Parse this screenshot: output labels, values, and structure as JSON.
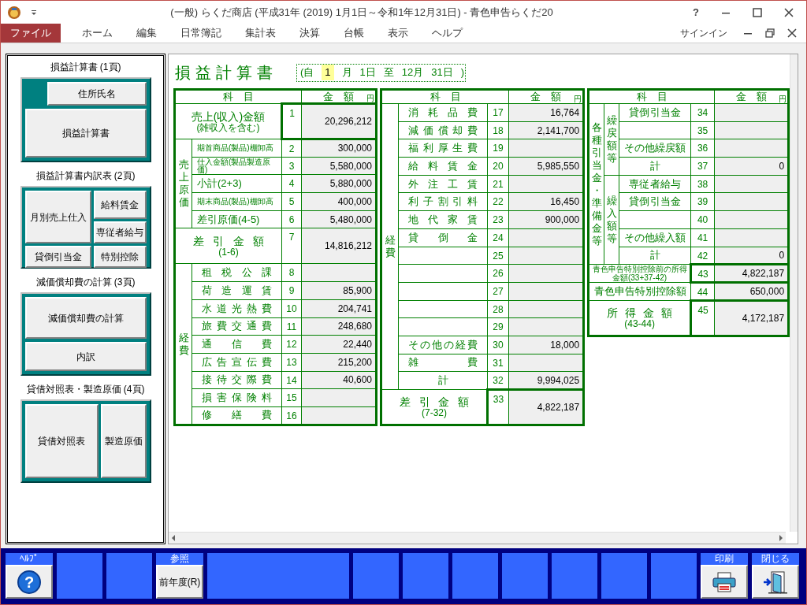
{
  "window": {
    "title": "(一般) らくだ商店 (平成31年 (2019) 1月1日～令和1年12月31日) - 青色申告らくだ20",
    "help": "?"
  },
  "menu": {
    "items": [
      {
        "label": "ファイル",
        "selected": true
      },
      {
        "label": "ホーム",
        "selected": false
      },
      {
        "label": "編集",
        "selected": false
      },
      {
        "label": "日常簿記",
        "selected": false
      },
      {
        "label": "集計表",
        "selected": false
      },
      {
        "label": "決算",
        "selected": false
      },
      {
        "label": "台帳",
        "selected": false
      },
      {
        "label": "表示",
        "selected": false
      },
      {
        "label": "ヘルプ",
        "selected": false
      }
    ],
    "signin": "サインイン"
  },
  "sidebar": {
    "sections": [
      {
        "title": "損益計算書 (1頁)",
        "kind": "offset",
        "buttons": [
          "住所氏名",
          "損益計算書"
        ]
      },
      {
        "title": "損益計算書内訳表 (2頁)",
        "kind": "grid",
        "buttons": [
          "月別売上仕入",
          "貸倒引当金",
          "給料賃金",
          "専従者給与",
          "特別控除"
        ]
      },
      {
        "title": "減価償却費の計算 (3頁)",
        "kind": "stack",
        "buttons": [
          "減価償却費の計算",
          "内訳"
        ]
      },
      {
        "title": "貸借対照表・製造原価 (4頁)",
        "kind": "columns",
        "buttons": [
          "貸借対照表",
          "製造原価"
        ]
      }
    ]
  },
  "form": {
    "title": "損益計算書",
    "period": [
      {
        "text": "(自",
        "highlighted": false
      },
      {
        "text": "1",
        "highlighted": true
      },
      {
        "text": "月",
        "highlighted": false
      },
      {
        "text": "1日",
        "highlighted": false
      },
      {
        "text": "至",
        "highlighted": false
      },
      {
        "text": "12月",
        "highlighted": false
      },
      {
        "text": "31日",
        "highlighted": false
      },
      {
        "text": ")",
        "highlighted": false
      }
    ],
    "tables": [
      {
        "columns": [
          {
            "label": "科　目"
          },
          {
            "label": "金　額",
            "unit": "円"
          }
        ],
        "blocks": [
          {
            "kind": "total-center",
            "label": "売上(収入)金額",
            "note": "(雑収入を含む)",
            "no": "1",
            "amount": "20,296,212",
            "emphasized": true
          },
          {
            "kind": "group",
            "label": "売上原価",
            "children": [
              {
                "kind": "row-left-small",
                "label": "期首商品(製品)棚卸高",
                "no": "2",
                "amount": "300,000"
              },
              {
                "kind": "row-left-small",
                "label": "仕入金額(製品製造原価)",
                "no": "3",
                "amount": "5,580,000"
              },
              {
                "kind": "row-left",
                "label": "小計(2+3)",
                "no": "4",
                "amount": "5,880,000"
              },
              {
                "kind": "row-left-small",
                "label": "期末商品(製品)棚卸高",
                "no": "5",
                "amount": "400,000"
              },
              {
                "kind": "row-left",
                "label": "差引原価(4-5)",
                "no": "6",
                "amount": "5,480,000"
              }
            ]
          },
          {
            "kind": "total-spread",
            "label": "差引金額",
            "note": "(1-6)",
            "no": "7",
            "amount": "14,816,212",
            "emphasized": false
          },
          {
            "kind": "group",
            "label": "経費",
            "children": [
              {
                "kind": "row-spread",
                "label": "租税公課",
                "no": "8"
              },
              {
                "kind": "row-spread",
                "label": "荷造運賃",
                "no": "9",
                "amount": "85,900"
              },
              {
                "kind": "row-spread",
                "label": "水道光熱費",
                "no": "10",
                "amount": "204,741"
              },
              {
                "kind": "row-spread",
                "label": "旅費交通費",
                "no": "11",
                "amount": "248,680"
              },
              {
                "kind": "row-spread",
                "label": "通信費",
                "no": "12",
                "amount": "22,440"
              },
              {
                "kind": "row-spread",
                "label": "広告宣伝費",
                "no": "13",
                "amount": "215,200"
              },
              {
                "kind": "row-spread",
                "label": "接待交際費",
                "no": "14",
                "amount": "40,600"
              },
              {
                "kind": "row-spread",
                "label": "損害保険料",
                "no": "15"
              },
              {
                "kind": "row-spread",
                "label": "修繕費",
                "no": "16"
              }
            ]
          }
        ]
      },
      {
        "columns": [
          {
            "label": "科　目"
          },
          {
            "label": "金　額",
            "unit": "円"
          }
        ],
        "blocks": [
          {
            "kind": "group",
            "label": "経費",
            "children": [
              {
                "kind": "row-spread",
                "label": "消耗品費",
                "no": "17",
                "amount": "16,764"
              },
              {
                "kind": "row-spread",
                "label": "減価償却費",
                "no": "18",
                "amount": "2,141,700"
              },
              {
                "kind": "row-spread",
                "label": "福利厚生費",
                "no": "19"
              },
              {
                "kind": "row-spread",
                "label": "給料賃金",
                "no": "20",
                "amount": "5,985,550"
              },
              {
                "kind": "row-spread",
                "label": "外注工賃",
                "no": "21"
              },
              {
                "kind": "row-spread",
                "label": "利子割引料",
                "no": "22",
                "amount": "16,450"
              },
              {
                "kind": "row-spread",
                "label": "地代家賃",
                "no": "23",
                "amount": "900,000"
              },
              {
                "kind": "row-spread",
                "label": "貸倒金",
                "no": "24"
              },
              {
                "kind": "row-blank",
                "no": "25"
              },
              {
                "kind": "row-blank",
                "no": "26"
              },
              {
                "kind": "row-blank",
                "no": "27"
              },
              {
                "kind": "row-blank",
                "no": "28"
              },
              {
                "kind": "row-blank",
                "no": "29"
              },
              {
                "kind": "row-spread",
                "label": "その他の経費",
                "no": "30",
                "amount": "18,000"
              },
              {
                "kind": "row-spread",
                "label": "雑費",
                "no": "31"
              },
              {
                "kind": "row-center",
                "label": "計",
                "no": "32",
                "amount": "9,994,025"
              }
            ]
          },
          {
            "kind": "total-spread",
            "label": "差引金額",
            "note": "(7-32)",
            "no": "33",
            "amount": "4,822,187",
            "emphasized": true
          }
        ]
      },
      {
        "columns": [
          {
            "label": "科　目"
          },
          {
            "label": "金　額",
            "unit": "円"
          }
        ],
        "blocks": [
          {
            "kind": "group",
            "label": "各種引当金・準備金等",
            "children": [
              {
                "kind": "group",
                "label": "繰戻額等",
                "children": [
                  {
                    "kind": "row-spread",
                    "label": "貸倒引当金",
                    "no": "34"
                  },
                  {
                    "kind": "row-blank",
                    "no": "35"
                  },
                  {
                    "kind": "row-center",
                    "label": "その他繰戻額",
                    "no": "36"
                  },
                  {
                    "kind": "row-center",
                    "label": "計",
                    "no": "37",
                    "amount": "0"
                  }
                ]
              },
              {
                "kind": "group",
                "label": "繰入額等",
                "children": [
                  {
                    "kind": "row-spread",
                    "label": "専従者給与",
                    "no": "38"
                  },
                  {
                    "kind": "row-spread",
                    "label": "貸倒引当金",
                    "no": "39"
                  },
                  {
                    "kind": "row-blank",
                    "no": "40"
                  },
                  {
                    "kind": "row-center",
                    "label": "その他繰入額",
                    "no": "41"
                  },
                  {
                    "kind": "row-center",
                    "label": "計",
                    "no": "42",
                    "amount": "0"
                  }
                ]
              }
            ]
          },
          {
            "kind": "row-center-small",
            "label": "青色申告特別控除前の所得金額(33+37-42)",
            "no": "43",
            "amount": "4,822,187",
            "emphasized": true
          },
          {
            "kind": "row-center",
            "label": "青色申告特別控除額",
            "no": "44",
            "amount": "650,000"
          },
          {
            "kind": "total-spread",
            "label": "所得金額",
            "note": "(43-44)",
            "no": "45",
            "amount": "4,172,187",
            "emphasized": true
          }
        ]
      }
    ]
  },
  "function_keys": [
    {
      "kind": "help",
      "header": "ﾍﾙﾌﾟ",
      "glyph": "?"
    },
    {
      "kind": "empty"
    },
    {
      "kind": "empty"
    },
    {
      "kind": "text",
      "header": "参照",
      "label": "前年度(R)"
    },
    {
      "kind": "empty-wide"
    },
    {
      "kind": "empty"
    },
    {
      "kind": "empty"
    },
    {
      "kind": "empty"
    },
    {
      "kind": "empty"
    },
    {
      "kind": "empty"
    },
    {
      "kind": "empty"
    },
    {
      "kind": "empty"
    },
    {
      "kind": "print",
      "header": "印刷"
    },
    {
      "kind": "exit",
      "header": "閉じる"
    }
  ]
}
